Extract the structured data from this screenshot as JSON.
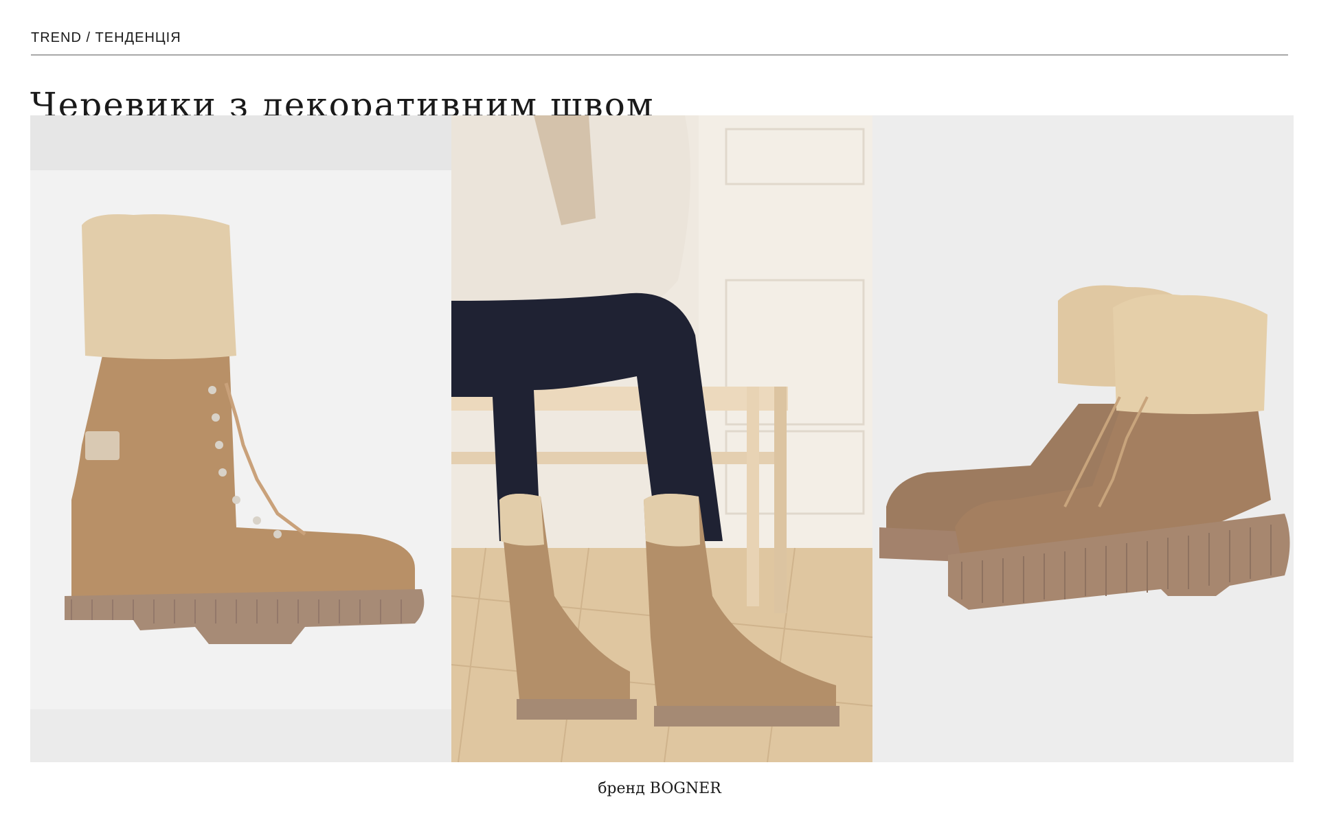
{
  "header": {
    "label": "TREND / ТЕНДЕНЦІЯ",
    "title": "Черевики з декоративним швом"
  },
  "gallery": {
    "images": [
      {
        "name": "tall-lace-up-shearling-cuff-boot-photo"
      },
      {
        "name": "model-seated-wearing-boots-photo"
      },
      {
        "name": "pair-of-shearling-ankle-boots-photo"
      }
    ]
  },
  "footer": {
    "caption": "бренд BOGNER"
  },
  "colors": {
    "background": "#ffffff",
    "rule": "#a8a8a8",
    "suede": "#b08a63",
    "shearling": "#e0cba8",
    "sole": "#a58a74"
  }
}
